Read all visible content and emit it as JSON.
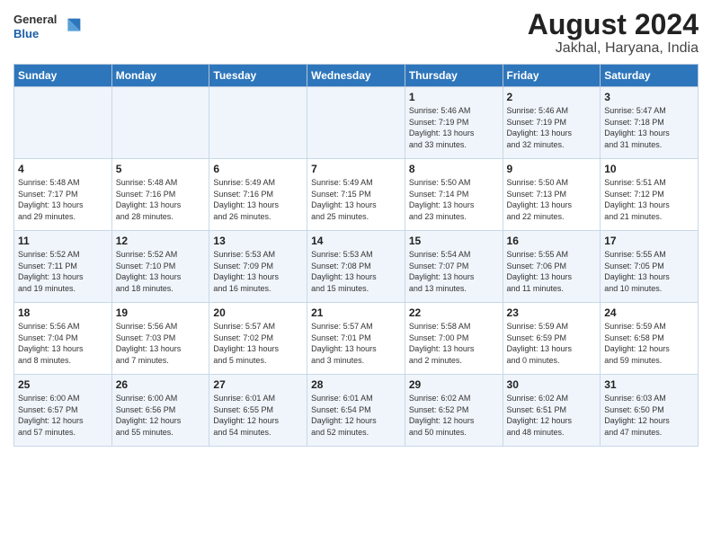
{
  "logo": {
    "general": "General",
    "blue": "Blue"
  },
  "title": "August 2024",
  "subtitle": "Jakhal, Haryana, India",
  "days_of_week": [
    "Sunday",
    "Monday",
    "Tuesday",
    "Wednesday",
    "Thursday",
    "Friday",
    "Saturday"
  ],
  "weeks": [
    [
      {
        "day": "",
        "content": ""
      },
      {
        "day": "",
        "content": ""
      },
      {
        "day": "",
        "content": ""
      },
      {
        "day": "",
        "content": ""
      },
      {
        "day": "1",
        "content": "Sunrise: 5:46 AM\nSunset: 7:19 PM\nDaylight: 13 hours\nand 33 minutes."
      },
      {
        "day": "2",
        "content": "Sunrise: 5:46 AM\nSunset: 7:19 PM\nDaylight: 13 hours\nand 32 minutes."
      },
      {
        "day": "3",
        "content": "Sunrise: 5:47 AM\nSunset: 7:18 PM\nDaylight: 13 hours\nand 31 minutes."
      }
    ],
    [
      {
        "day": "4",
        "content": "Sunrise: 5:48 AM\nSunset: 7:17 PM\nDaylight: 13 hours\nand 29 minutes."
      },
      {
        "day": "5",
        "content": "Sunrise: 5:48 AM\nSunset: 7:16 PM\nDaylight: 13 hours\nand 28 minutes."
      },
      {
        "day": "6",
        "content": "Sunrise: 5:49 AM\nSunset: 7:16 PM\nDaylight: 13 hours\nand 26 minutes."
      },
      {
        "day": "7",
        "content": "Sunrise: 5:49 AM\nSunset: 7:15 PM\nDaylight: 13 hours\nand 25 minutes."
      },
      {
        "day": "8",
        "content": "Sunrise: 5:50 AM\nSunset: 7:14 PM\nDaylight: 13 hours\nand 23 minutes."
      },
      {
        "day": "9",
        "content": "Sunrise: 5:50 AM\nSunset: 7:13 PM\nDaylight: 13 hours\nand 22 minutes."
      },
      {
        "day": "10",
        "content": "Sunrise: 5:51 AM\nSunset: 7:12 PM\nDaylight: 13 hours\nand 21 minutes."
      }
    ],
    [
      {
        "day": "11",
        "content": "Sunrise: 5:52 AM\nSunset: 7:11 PM\nDaylight: 13 hours\nand 19 minutes."
      },
      {
        "day": "12",
        "content": "Sunrise: 5:52 AM\nSunset: 7:10 PM\nDaylight: 13 hours\nand 18 minutes."
      },
      {
        "day": "13",
        "content": "Sunrise: 5:53 AM\nSunset: 7:09 PM\nDaylight: 13 hours\nand 16 minutes."
      },
      {
        "day": "14",
        "content": "Sunrise: 5:53 AM\nSunset: 7:08 PM\nDaylight: 13 hours\nand 15 minutes."
      },
      {
        "day": "15",
        "content": "Sunrise: 5:54 AM\nSunset: 7:07 PM\nDaylight: 13 hours\nand 13 minutes."
      },
      {
        "day": "16",
        "content": "Sunrise: 5:55 AM\nSunset: 7:06 PM\nDaylight: 13 hours\nand 11 minutes."
      },
      {
        "day": "17",
        "content": "Sunrise: 5:55 AM\nSunset: 7:05 PM\nDaylight: 13 hours\nand 10 minutes."
      }
    ],
    [
      {
        "day": "18",
        "content": "Sunrise: 5:56 AM\nSunset: 7:04 PM\nDaylight: 13 hours\nand 8 minutes."
      },
      {
        "day": "19",
        "content": "Sunrise: 5:56 AM\nSunset: 7:03 PM\nDaylight: 13 hours\nand 7 minutes."
      },
      {
        "day": "20",
        "content": "Sunrise: 5:57 AM\nSunset: 7:02 PM\nDaylight: 13 hours\nand 5 minutes."
      },
      {
        "day": "21",
        "content": "Sunrise: 5:57 AM\nSunset: 7:01 PM\nDaylight: 13 hours\nand 3 minutes."
      },
      {
        "day": "22",
        "content": "Sunrise: 5:58 AM\nSunset: 7:00 PM\nDaylight: 13 hours\nand 2 minutes."
      },
      {
        "day": "23",
        "content": "Sunrise: 5:59 AM\nSunset: 6:59 PM\nDaylight: 13 hours\nand 0 minutes."
      },
      {
        "day": "24",
        "content": "Sunrise: 5:59 AM\nSunset: 6:58 PM\nDaylight: 12 hours\nand 59 minutes."
      }
    ],
    [
      {
        "day": "25",
        "content": "Sunrise: 6:00 AM\nSunset: 6:57 PM\nDaylight: 12 hours\nand 57 minutes."
      },
      {
        "day": "26",
        "content": "Sunrise: 6:00 AM\nSunset: 6:56 PM\nDaylight: 12 hours\nand 55 minutes."
      },
      {
        "day": "27",
        "content": "Sunrise: 6:01 AM\nSunset: 6:55 PM\nDaylight: 12 hours\nand 54 minutes."
      },
      {
        "day": "28",
        "content": "Sunrise: 6:01 AM\nSunset: 6:54 PM\nDaylight: 12 hours\nand 52 minutes."
      },
      {
        "day": "29",
        "content": "Sunrise: 6:02 AM\nSunset: 6:52 PM\nDaylight: 12 hours\nand 50 minutes."
      },
      {
        "day": "30",
        "content": "Sunrise: 6:02 AM\nSunset: 6:51 PM\nDaylight: 12 hours\nand 48 minutes."
      },
      {
        "day": "31",
        "content": "Sunrise: 6:03 AM\nSunset: 6:50 PM\nDaylight: 12 hours\nand 47 minutes."
      }
    ]
  ]
}
